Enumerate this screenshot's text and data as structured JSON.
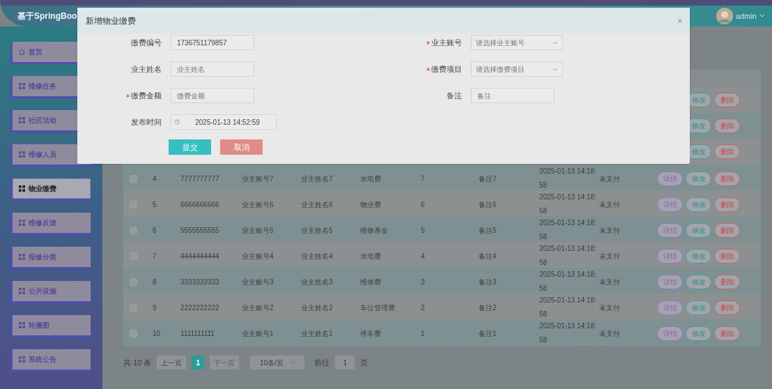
{
  "header": {
    "title": "基于SpringBoo",
    "user": "admin"
  },
  "sidebar": {
    "items": [
      {
        "label": "首页",
        "selected": false
      },
      {
        "label": "维修任务",
        "selected": false
      },
      {
        "label": "社区活动",
        "selected": false
      },
      {
        "label": "维修人员",
        "selected": false
      },
      {
        "label": "物业缴费",
        "selected": true
      },
      {
        "label": "维修反馈",
        "selected": false
      },
      {
        "label": "报修分类",
        "selected": false
      },
      {
        "label": "公共设施",
        "selected": false
      },
      {
        "label": "轮播图",
        "selected": false
      },
      {
        "label": "系统公告",
        "selected": false
      }
    ]
  },
  "table": {
    "covered_rows": [
      {
        "actions": [
          "修改",
          "删除"
        ]
      },
      {
        "actions": [
          "修改",
          "删除"
        ]
      },
      {
        "actions": [
          "修改",
          "删除"
        ]
      }
    ],
    "rows": [
      {
        "checked": false,
        "cells": [
          "4",
          "7777777777",
          "业主账号7",
          "业主姓名7",
          "水电费",
          "7",
          "备注7",
          "2025-01-13 14:18:58",
          "未支付"
        ],
        "actions": [
          "详情",
          "修改",
          "删除"
        ]
      },
      {
        "checked": false,
        "cells": [
          "5",
          "6666666666",
          "业主账号6",
          "业主姓名6",
          "物业费",
          "6",
          "备注6",
          "2025-01-13 14:18:58",
          "未支付"
        ],
        "actions": [
          "详情",
          "修改",
          "删除"
        ]
      },
      {
        "checked": false,
        "cells": [
          "6",
          "5555555555",
          "业主账号5",
          "业主姓名5",
          "维修基金",
          "5",
          "备注5",
          "2025-01-13 14:18:58",
          "未支付"
        ],
        "actions": [
          "详情",
          "修改",
          "删除"
        ]
      },
      {
        "checked": false,
        "cells": [
          "7",
          "4444444444",
          "业主账号4",
          "业主姓名4",
          "水电费",
          "4",
          "备注4",
          "2025-01-13 14:18:58",
          "未支付"
        ],
        "actions": [
          "详情",
          "修改",
          "删除"
        ]
      },
      {
        "checked": false,
        "cells": [
          "8",
          "3333333333",
          "业主账号3",
          "业主姓名3",
          "维修费",
          "3",
          "备注3",
          "2025-01-13 14:18:58",
          "未支付"
        ],
        "actions": [
          "详情",
          "修改",
          "删除"
        ]
      },
      {
        "checked": false,
        "cells": [
          "9",
          "2222222222",
          "业主账号2",
          "业主姓名2",
          "车位管理费",
          "2",
          "备注2",
          "2025-01-13 14:18:58",
          "未支付"
        ],
        "actions": [
          "详情",
          "修改",
          "删除"
        ]
      },
      {
        "checked": false,
        "cells": [
          "10",
          "1111111111",
          "业主账号1",
          "业主姓名1",
          "停车费",
          "1",
          "备注1",
          "2025-01-13 14:18:58",
          "未支付"
        ],
        "actions": [
          "详情",
          "修改",
          "删除"
        ]
      }
    ]
  },
  "pagination": {
    "total": "共 10 条",
    "prev": "上一页",
    "pages": [
      {
        "label": "1",
        "selected": true
      }
    ],
    "next": "下一页",
    "page_size": "10条/页",
    "goto_label": "前往",
    "goto_value": "1",
    "goto_suffix": "页"
  },
  "dialog": {
    "title": "新增物业缴费",
    "close": "×",
    "fields": [
      {
        "label": "缴费编号",
        "required": false,
        "kind": "input",
        "value": "1736751179857"
      },
      {
        "label": "业主账号",
        "required": true,
        "kind": "select",
        "placeholder": "请选择业主账号"
      },
      {
        "label": "业主姓名",
        "required": false,
        "kind": "input",
        "placeholder": "业主姓名"
      },
      {
        "label": "缴费项目",
        "required": true,
        "kind": "select",
        "placeholder": "请选择缴费项目"
      },
      {
        "label": "缴费金额",
        "required": true,
        "kind": "input",
        "placeholder": "缴费金额"
      },
      {
        "label": "备注",
        "required": false,
        "kind": "input",
        "placeholder": "备注"
      },
      {
        "label": "发布时间",
        "required": false,
        "kind": "datetime",
        "value": "2025-01-13 14:52:59"
      }
    ],
    "buttons": [
      {
        "label": "提交",
        "kind": "primary"
      },
      {
        "label": "取消",
        "kind": "cancel"
      }
    ]
  }
}
